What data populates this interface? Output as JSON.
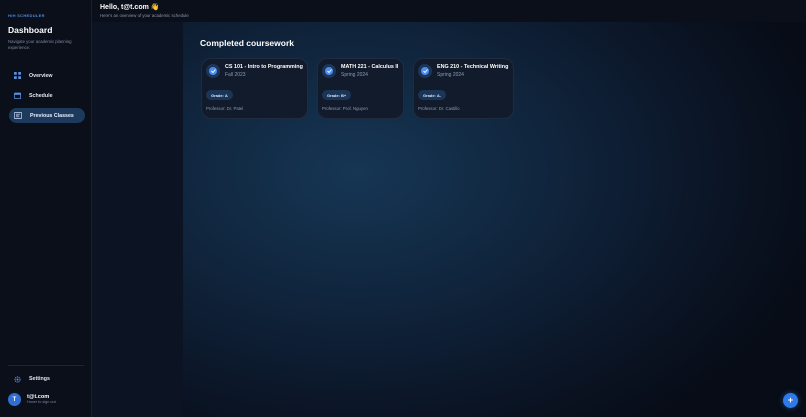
{
  "sidebar": {
    "brand": "HIH SCHEDULER",
    "title": "Dashboard",
    "description": "Navigate your academic planning experience.",
    "nav": [
      {
        "label": "Overview",
        "icon": "grid-icon"
      },
      {
        "label": "Schedule",
        "icon": "calendar-icon"
      },
      {
        "label": "Previous Classes",
        "icon": "history-icon",
        "active": true
      }
    ],
    "settings_label": "Settings",
    "user": {
      "initial": "T",
      "name": "t@t.com",
      "hint": "Hover to sign out"
    }
  },
  "header": {
    "greeting": "Hello, t@t.com 👋",
    "subtitle": "Here's an overview of your academic schedule"
  },
  "main": {
    "section_title": "Completed coursework",
    "courses": [
      {
        "title": "CS 101 - Intro to Programming",
        "term": "Fall 2023",
        "grade": "Grade: A",
        "professor": "Professor: Dr. Patel"
      },
      {
        "title": "MATH 221 - Calculus II",
        "term": "Spring 2024",
        "grade": "Grade: B+",
        "professor": "Professor: Prof. Nguyen"
      },
      {
        "title": "ENG 210 - Technical Writing",
        "term": "Spring 2024",
        "grade": "Grade: A-",
        "professor": "Professor: Dr. Castillo"
      }
    ]
  },
  "fab_label": "+",
  "colors": {
    "accent": "#2f7ae8",
    "active_nav": "#1d3a5c",
    "sidebar_bg": "#0a0f1a"
  }
}
